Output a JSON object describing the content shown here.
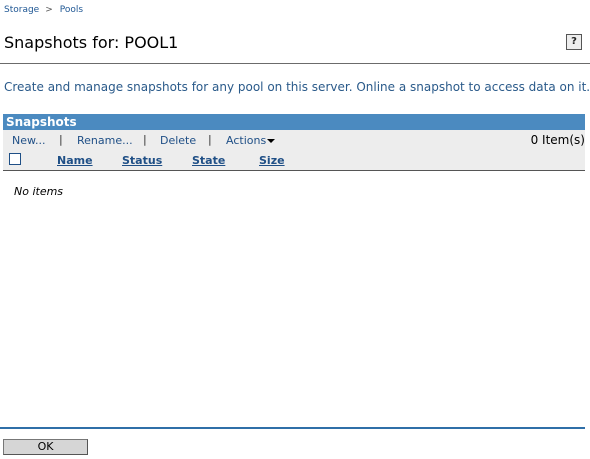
{
  "breadcrumb": {
    "items": [
      "Storage",
      "Pools"
    ],
    "separator": ">"
  },
  "header": {
    "title": "Snapshots for: POOL1",
    "help_label": "?"
  },
  "description": "Create and manage snapshots for any pool on this server. Online a snapshot to access data on it.",
  "panel": {
    "title": "Snapshots",
    "toolbar": {
      "new_label": "New...",
      "rename_label": "Rename...",
      "delete_label": "Delete",
      "actions_label": "Actions",
      "separator": "|"
    },
    "item_count": "0 Item(s)",
    "columns": [
      "Name",
      "Status",
      "State",
      "Size"
    ],
    "empty_text": "No items"
  },
  "footer": {
    "ok_label": "OK"
  },
  "colors": {
    "accent": "#4b8ac0",
    "link": "#1f4f86",
    "toolbar_bg": "#ededed"
  }
}
